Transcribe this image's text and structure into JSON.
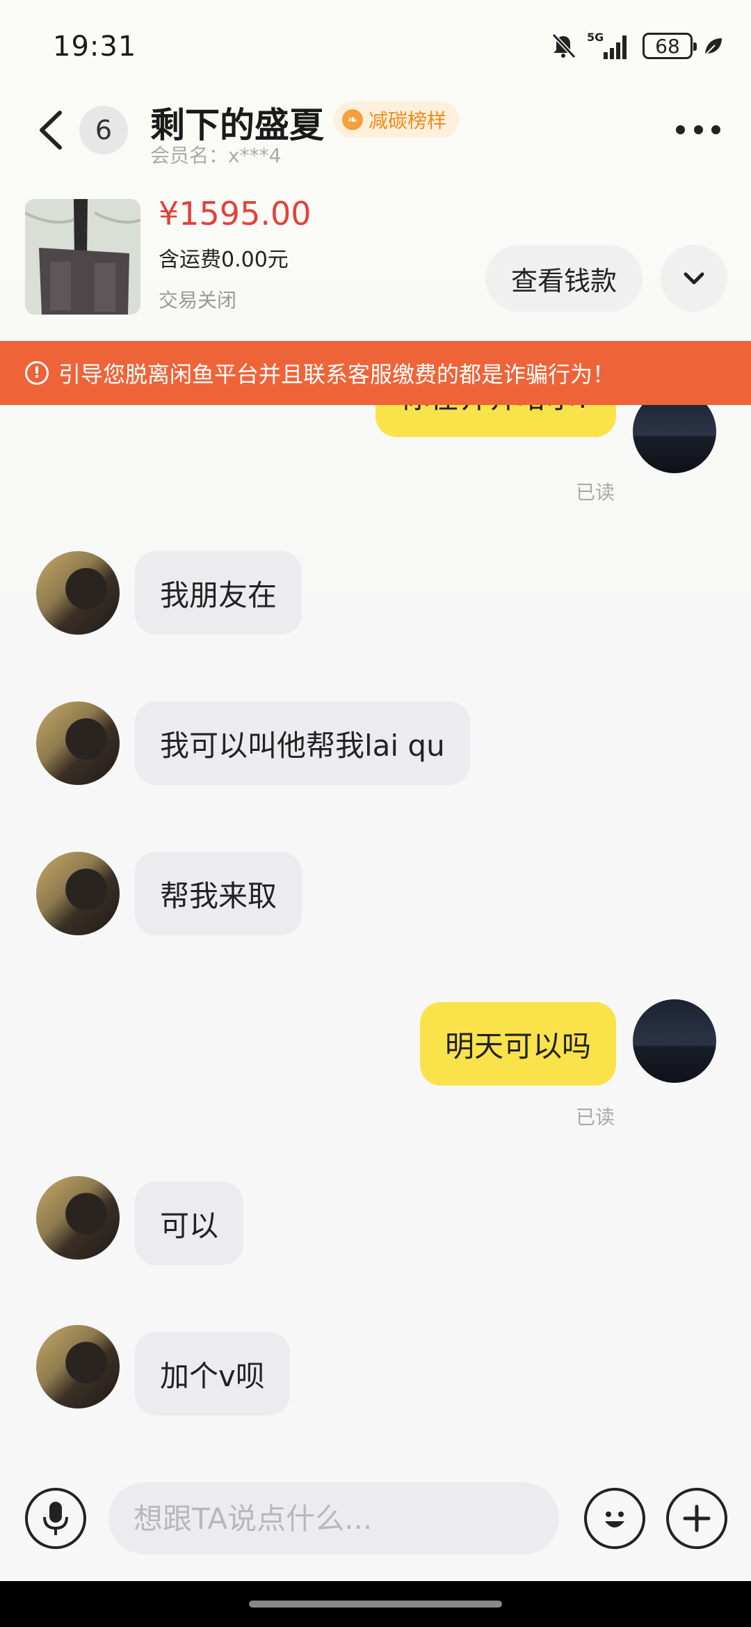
{
  "status_bar": {
    "time": "19:31",
    "battery": "68",
    "network": "5G"
  },
  "header": {
    "unread_count": "6",
    "title": "剩下的盛夏",
    "badge": "减碳榜样",
    "member": "会员名：x***4"
  },
  "product": {
    "price": "¥1595.00",
    "shipping": "含运费0.00元",
    "status": "交易关闭",
    "view_button": "查看钱款"
  },
  "warning": {
    "text": "引导您脱离闲鱼平台并且联系客服缴费的都是诈骗行为！"
  },
  "messages": [
    {
      "side": "self",
      "text": "你在齐齐哈尔?",
      "read": "已读"
    },
    {
      "side": "other",
      "text": "我朋友在"
    },
    {
      "side": "other",
      "text": "我可以叫他帮我lai qu"
    },
    {
      "side": "other",
      "text": "帮我来取"
    },
    {
      "side": "self",
      "text": "明天可以吗",
      "read": "已读"
    },
    {
      "side": "other",
      "text": "可以"
    },
    {
      "side": "other",
      "text": "加个v呗"
    }
  ],
  "input": {
    "placeholder": "想跟TA说点什么..."
  },
  "icons": [
    "back-icon",
    "bell-mute-icon",
    "signal-icon",
    "battery-icon",
    "leaf-icon",
    "more-icon",
    "chevron-down-icon",
    "warning-icon",
    "mic-icon",
    "emoji-icon",
    "plus-icon"
  ],
  "colors": {
    "accent_yellow": "#fae34a",
    "price_red": "#e4403a",
    "warning_orange": "#ee6438",
    "badge_orange": "#f08a1c"
  }
}
